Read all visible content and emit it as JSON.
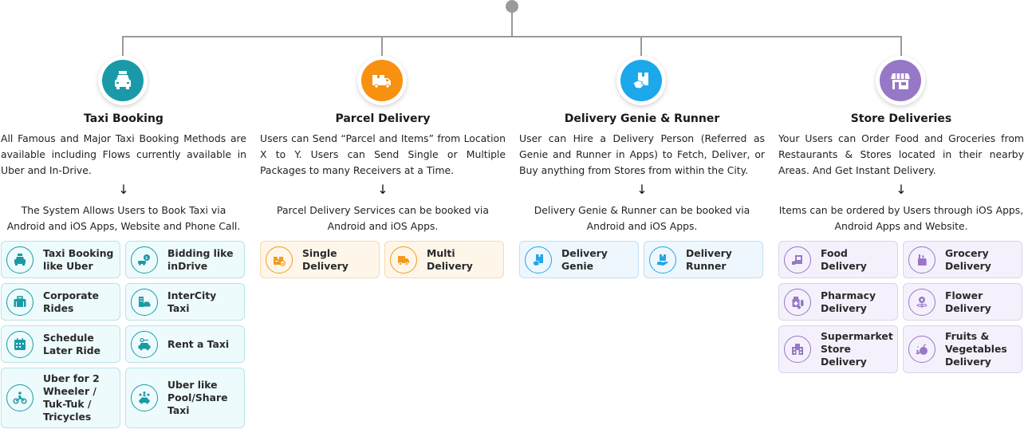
{
  "colors": {
    "connector": "#9a9a9a",
    "taxi": "#1a9aa8",
    "parcel": "#f7910f",
    "genie": "#1ca8ea",
    "store": "#9778c6"
  },
  "columns": [
    {
      "id": "taxi",
      "hub_icon": "taxi-car-icon",
      "title": "Taxi Booking",
      "description": "All Famous and Major Taxi Booking Methods are available including Flows currently available in Uber and In-Drive.",
      "arrow": "↓",
      "summary": "The System Allows Users to Book Taxi via Android and iOS Apps, Website and Phone Call.",
      "features": [
        {
          "label": "Taxi Booking like Uber",
          "icon": "taxi-icon"
        },
        {
          "label": "Bidding like inDrive",
          "icon": "bidding-car-icon"
        },
        {
          "label": "Corporate Rides",
          "icon": "briefcase-icon"
        },
        {
          "label": "InterCity Taxi",
          "icon": "city-car-icon"
        },
        {
          "label": "Schedule Later Ride",
          "icon": "calendar-icon"
        },
        {
          "label": "Rent a Taxi",
          "icon": "car-key-icon"
        },
        {
          "label": "Uber for 2 Wheeler / Tuk-Tuk / Tricycles",
          "icon": "motorbike-icon"
        },
        {
          "label": "Uber like Pool/Share Taxi",
          "icon": "carpool-icon"
        }
      ]
    },
    {
      "id": "parcel",
      "hub_icon": "delivery-truck-icon",
      "title": "Parcel Delivery",
      "description": "Users can Send “Parcel and Items” from Location X to Y. Users can Send Single or Multiple Packages to many Receivers at a Time.",
      "arrow": "↓",
      "summary": "Parcel Delivery Services can be booked via Android and iOS Apps.",
      "features": [
        {
          "label": "Single Delivery",
          "icon": "package-check-icon"
        },
        {
          "label": "Multi Delivery",
          "icon": "truck-icon"
        }
      ]
    },
    {
      "id": "genie",
      "hub_icon": "hand-package-icon",
      "title": "Delivery Genie & Runner",
      "description": "User can Hire a Delivery Person (Referred as Genie and Runner in Apps) to Fetch, Deliver, or Buy anything from Stores from within the City.",
      "arrow": "↓",
      "summary": "Delivery Genie & Runner can be booked via Android and iOS Apps.",
      "features": [
        {
          "label": "Delivery Genie",
          "icon": "hand-package-icon"
        },
        {
          "label": "Delivery Runner",
          "icon": "package-hand-icon"
        }
      ]
    },
    {
      "id": "store",
      "hub_icon": "storefront-icon",
      "title": "Store Deliveries",
      "description": "Your Users can Order Food and Groceries from Restaurants & Stores located in their nearby Areas. And Get Instant Delivery.",
      "arrow": "↓",
      "summary": "Items can be ordered by Users through iOS Apps, Android Apps and Website.",
      "features": [
        {
          "label": "Food Delivery",
          "icon": "food-bag-icon"
        },
        {
          "label": "Grocery Delivery",
          "icon": "grocery-bag-icon"
        },
        {
          "label": "Pharmacy Delivery",
          "icon": "medicine-icon"
        },
        {
          "label": "Flower Delivery",
          "icon": "flower-icon"
        },
        {
          "label": "Supermarket Store Delivery",
          "icon": "supermarket-icon"
        },
        {
          "label": "Fruits & Vegetables Delivery",
          "icon": "fruits-icon"
        }
      ]
    }
  ]
}
